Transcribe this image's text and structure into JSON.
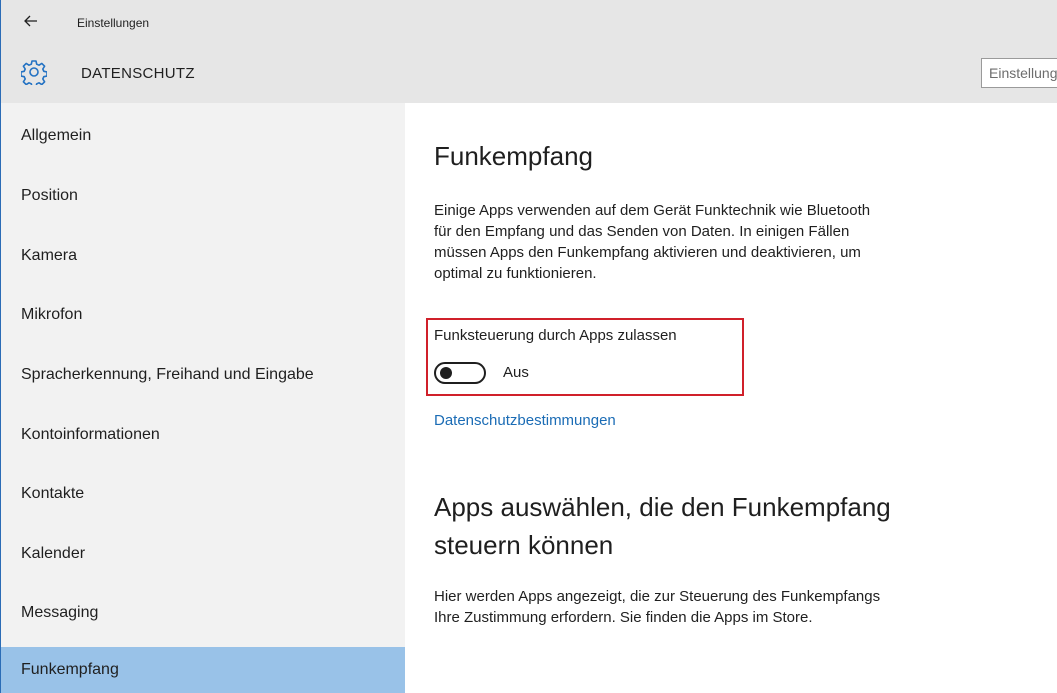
{
  "titlebar": {
    "back_icon": "arrow-left-icon",
    "title": "Einstellungen"
  },
  "header": {
    "icon": "gear-icon",
    "section": "DATENSCHUTZ",
    "search_placeholder": "Einstellung suchen"
  },
  "sidebar": {
    "items": [
      {
        "label": "Allgemein",
        "selected": false
      },
      {
        "label": "Position",
        "selected": false
      },
      {
        "label": "Kamera",
        "selected": false
      },
      {
        "label": "Mikrofon",
        "selected": false
      },
      {
        "label": "Spracherkennung, Freihand und Eingabe",
        "selected": false
      },
      {
        "label": "Kontoinformationen",
        "selected": false
      },
      {
        "label": "Kontakte",
        "selected": false
      },
      {
        "label": "Kalender",
        "selected": false
      },
      {
        "label": "Messaging",
        "selected": false
      },
      {
        "label": "Funkempfang",
        "selected": true
      }
    ]
  },
  "main": {
    "heading": "Funkempfang",
    "description_lines": [
      "Einige Apps verwenden auf dem Gerät Funktechnik wie Bluetooth",
      "für den Empfang und das Senden von Daten. In einigen Fällen",
      "müssen Apps den Funkempfang aktivieren und deaktivieren, um",
      "optimal zu funktionieren."
    ],
    "toggle": {
      "label": "Funksteuerung durch Apps zulassen",
      "state_text": "Aus",
      "on": false
    },
    "privacy_link": "Datenschutzbestimmungen",
    "subheading_lines": [
      "Apps auswählen, die den Funkempfang",
      "steuern können"
    ],
    "info_lines": [
      "Hier werden Apps angezeigt, die zur Steuerung des Funkempfangs",
      "Ihre Zustimmung erfordern. Sie finden die Apps im Store."
    ]
  },
  "colors": {
    "chrome": "#e6e6e6",
    "sidebar": "#f2f2f2",
    "selected": "#99c2e8",
    "link": "#1b6cb5",
    "highlight": "#d0202a"
  }
}
